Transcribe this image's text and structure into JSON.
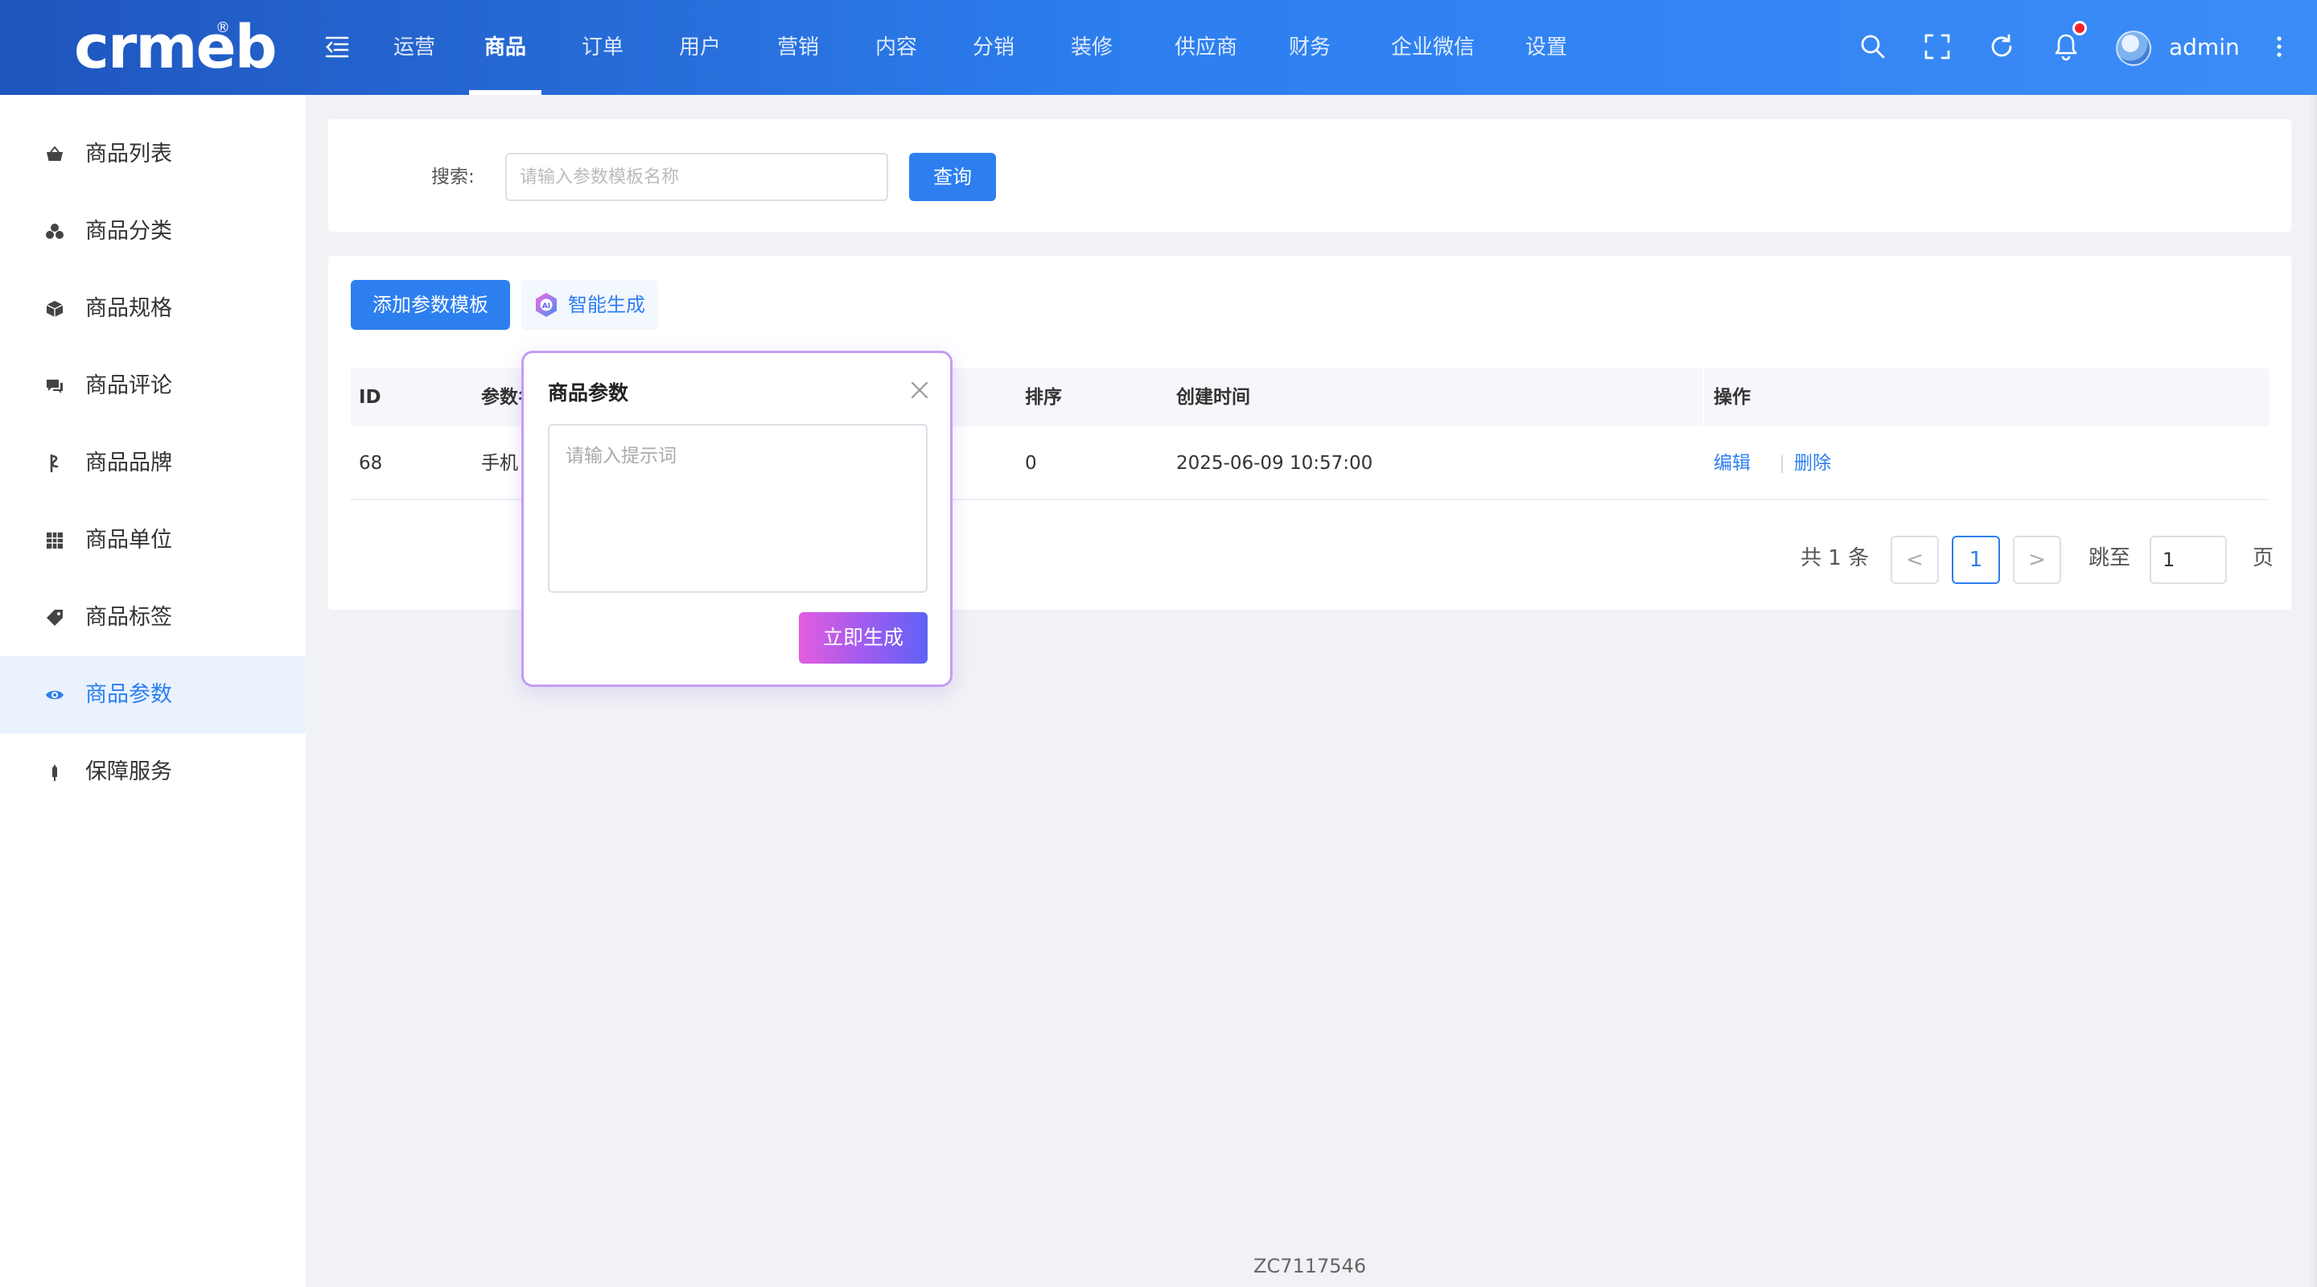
{
  "header": {
    "logo_text": "crmeb",
    "logo_reg": "®",
    "nav": [
      {
        "label": "运营"
      },
      {
        "label": "商品"
      },
      {
        "label": "订单"
      },
      {
        "label": "用户"
      },
      {
        "label": "营销"
      },
      {
        "label": "内容"
      },
      {
        "label": "分销"
      },
      {
        "label": "装修"
      },
      {
        "label": "供应商"
      },
      {
        "label": "财务"
      },
      {
        "label": "企业微信"
      },
      {
        "label": "设置"
      }
    ],
    "active_nav": "商品",
    "username": "admin",
    "icons": [
      "search-icon",
      "fullscreen-icon",
      "refresh-icon",
      "bell-icon",
      "more-icon"
    ]
  },
  "sidebar": {
    "items": [
      {
        "label": "商品列表",
        "icon": "basket-icon"
      },
      {
        "label": "商品分类",
        "icon": "category-icon"
      },
      {
        "label": "商品规格",
        "icon": "cube-icon"
      },
      {
        "label": "商品评论",
        "icon": "comment-icon"
      },
      {
        "label": "商品品牌",
        "icon": "brand-icon"
      },
      {
        "label": "商品单位",
        "icon": "grid-icon"
      },
      {
        "label": "商品标签",
        "icon": "tag-icon"
      },
      {
        "label": "商品参数",
        "icon": "eye-icon"
      },
      {
        "label": "保障服务",
        "icon": "service-icon"
      }
    ],
    "active": "商品参数"
  },
  "search": {
    "label": "搜索:",
    "placeholder": "请输入参数模板名称",
    "value": "",
    "button": "查询"
  },
  "toolbar": {
    "add_label": "添加参数模板",
    "ai_label": "智能生成"
  },
  "table": {
    "columns": {
      "id": "ID",
      "name": "参数名称",
      "sort": "排序",
      "created": "创建时间",
      "actions": "操作"
    },
    "rows": [
      {
        "id": "68",
        "name": "手机",
        "sort": "0",
        "created": "2025-06-09 10:57:00",
        "edit": "编辑",
        "delete": "删除"
      }
    ]
  },
  "pagination": {
    "total": "共 1 条",
    "prev": "<",
    "current": "1",
    "next": ">",
    "jump_label": "跳至",
    "jump_value": "1",
    "page_suffix": "页"
  },
  "popover": {
    "title": "商品参数",
    "placeholder": "请输入提示词",
    "button": "立即生成"
  },
  "footer": {
    "code": "ZC7117546"
  },
  "colors": {
    "primary": "#2d7ff0",
    "header_start": "#1f55bd",
    "sidebar_active_bg": "#eaf2fe",
    "popover_border": "#c49cf4",
    "generate_gradient_start": "#e45ce0",
    "generate_gradient_end": "#5f62f5"
  }
}
